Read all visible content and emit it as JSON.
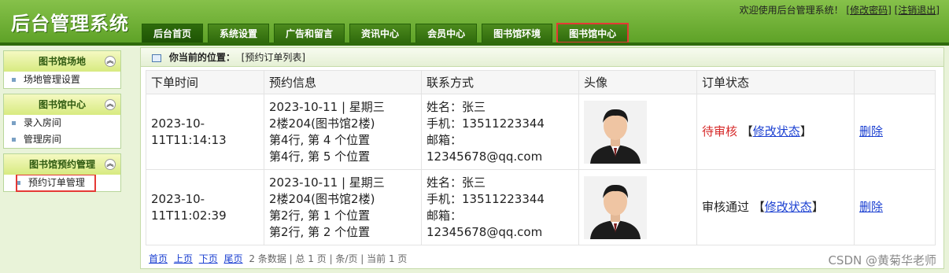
{
  "app": {
    "title": "后台管理系统"
  },
  "welcome": {
    "text": "欢迎使用后台管理系统！",
    "change_password": "[修改密码]",
    "logout": "[注销退出]"
  },
  "nav": [
    "后台首页",
    "系统设置",
    "广告和留言",
    "资讯中心",
    "会员中心",
    "图书馆环境",
    "图书馆中心"
  ],
  "sidebar": [
    {
      "title": "图书馆场地",
      "items": [
        "场地管理设置"
      ]
    },
    {
      "title": "图书馆中心",
      "items": [
        "录入房间",
        "管理房间"
      ]
    },
    {
      "title": "图书馆预约管理",
      "items": [
        "预约订单管理"
      ]
    }
  ],
  "breadcrumb": {
    "label": "你当前的位置：",
    "value": "[预约订单列表]"
  },
  "table": {
    "headers": [
      "下单时间",
      "预约信息",
      "联系方式",
      "头像",
      "订单状态",
      ""
    ],
    "rows": [
      {
        "time": "2023-10-11T11:14:13",
        "info": [
          "2023-10-11 | 星期三",
          "2楼204(图书馆2楼)",
          "第4行, 第 4 个位置",
          "第4行, 第 5 个位置"
        ],
        "contact": [
          "姓名：张三",
          "手机：13511223344",
          "邮箱：",
          "12345678@qq.com"
        ],
        "status": "待审核",
        "status_color": "#d62828",
        "modify": "修改状态",
        "delete": "删除"
      },
      {
        "time": "2023-10-11T11:02:39",
        "info": [
          "2023-10-11 | 星期三",
          "2楼204(图书馆2楼)",
          "第2行, 第 1 个位置",
          "第2行, 第 2 个位置"
        ],
        "contact": [
          "姓名：张三",
          "手机：13511223344",
          "邮箱：",
          "12345678@qq.com"
        ],
        "status": "审核通过",
        "status_color": "#222222",
        "modify": "修改状态",
        "delete": "删除"
      }
    ]
  },
  "pager": {
    "links": [
      "首页",
      "上页",
      "下页",
      "尾页"
    ],
    "summary": "2 条数据 | 总 1 页 | 条/页 | 当前 1 页"
  },
  "watermark": "CSDN @黄菊华老师"
}
